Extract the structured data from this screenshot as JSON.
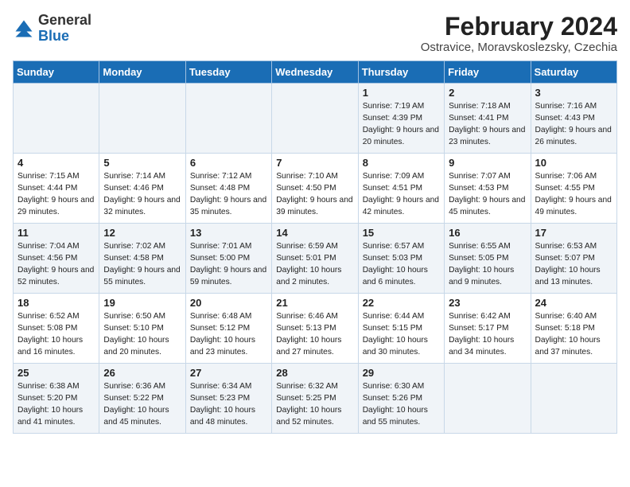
{
  "logo": {
    "general": "General",
    "blue": "Blue"
  },
  "title": "February 2024",
  "subtitle": "Ostravice, Moravskoslezsky, Czechia",
  "headers": [
    "Sunday",
    "Monday",
    "Tuesday",
    "Wednesday",
    "Thursday",
    "Friday",
    "Saturday"
  ],
  "weeks": [
    [
      {
        "day": "",
        "sunrise": "",
        "sunset": "",
        "daylight": ""
      },
      {
        "day": "",
        "sunrise": "",
        "sunset": "",
        "daylight": ""
      },
      {
        "day": "",
        "sunrise": "",
        "sunset": "",
        "daylight": ""
      },
      {
        "day": "",
        "sunrise": "",
        "sunset": "",
        "daylight": ""
      },
      {
        "day": "1",
        "sunrise": "Sunrise: 7:19 AM",
        "sunset": "Sunset: 4:39 PM",
        "daylight": "Daylight: 9 hours and 20 minutes."
      },
      {
        "day": "2",
        "sunrise": "Sunrise: 7:18 AM",
        "sunset": "Sunset: 4:41 PM",
        "daylight": "Daylight: 9 hours and 23 minutes."
      },
      {
        "day": "3",
        "sunrise": "Sunrise: 7:16 AM",
        "sunset": "Sunset: 4:43 PM",
        "daylight": "Daylight: 9 hours and 26 minutes."
      }
    ],
    [
      {
        "day": "4",
        "sunrise": "Sunrise: 7:15 AM",
        "sunset": "Sunset: 4:44 PM",
        "daylight": "Daylight: 9 hours and 29 minutes."
      },
      {
        "day": "5",
        "sunrise": "Sunrise: 7:14 AM",
        "sunset": "Sunset: 4:46 PM",
        "daylight": "Daylight: 9 hours and 32 minutes."
      },
      {
        "day": "6",
        "sunrise": "Sunrise: 7:12 AM",
        "sunset": "Sunset: 4:48 PM",
        "daylight": "Daylight: 9 hours and 35 minutes."
      },
      {
        "day": "7",
        "sunrise": "Sunrise: 7:10 AM",
        "sunset": "Sunset: 4:50 PM",
        "daylight": "Daylight: 9 hours and 39 minutes."
      },
      {
        "day": "8",
        "sunrise": "Sunrise: 7:09 AM",
        "sunset": "Sunset: 4:51 PM",
        "daylight": "Daylight: 9 hours and 42 minutes."
      },
      {
        "day": "9",
        "sunrise": "Sunrise: 7:07 AM",
        "sunset": "Sunset: 4:53 PM",
        "daylight": "Daylight: 9 hours and 45 minutes."
      },
      {
        "day": "10",
        "sunrise": "Sunrise: 7:06 AM",
        "sunset": "Sunset: 4:55 PM",
        "daylight": "Daylight: 9 hours and 49 minutes."
      }
    ],
    [
      {
        "day": "11",
        "sunrise": "Sunrise: 7:04 AM",
        "sunset": "Sunset: 4:56 PM",
        "daylight": "Daylight: 9 hours and 52 minutes."
      },
      {
        "day": "12",
        "sunrise": "Sunrise: 7:02 AM",
        "sunset": "Sunset: 4:58 PM",
        "daylight": "Daylight: 9 hours and 55 minutes."
      },
      {
        "day": "13",
        "sunrise": "Sunrise: 7:01 AM",
        "sunset": "Sunset: 5:00 PM",
        "daylight": "Daylight: 9 hours and 59 minutes."
      },
      {
        "day": "14",
        "sunrise": "Sunrise: 6:59 AM",
        "sunset": "Sunset: 5:01 PM",
        "daylight": "Daylight: 10 hours and 2 minutes."
      },
      {
        "day": "15",
        "sunrise": "Sunrise: 6:57 AM",
        "sunset": "Sunset: 5:03 PM",
        "daylight": "Daylight: 10 hours and 6 minutes."
      },
      {
        "day": "16",
        "sunrise": "Sunrise: 6:55 AM",
        "sunset": "Sunset: 5:05 PM",
        "daylight": "Daylight: 10 hours and 9 minutes."
      },
      {
        "day": "17",
        "sunrise": "Sunrise: 6:53 AM",
        "sunset": "Sunset: 5:07 PM",
        "daylight": "Daylight: 10 hours and 13 minutes."
      }
    ],
    [
      {
        "day": "18",
        "sunrise": "Sunrise: 6:52 AM",
        "sunset": "Sunset: 5:08 PM",
        "daylight": "Daylight: 10 hours and 16 minutes."
      },
      {
        "day": "19",
        "sunrise": "Sunrise: 6:50 AM",
        "sunset": "Sunset: 5:10 PM",
        "daylight": "Daylight: 10 hours and 20 minutes."
      },
      {
        "day": "20",
        "sunrise": "Sunrise: 6:48 AM",
        "sunset": "Sunset: 5:12 PM",
        "daylight": "Daylight: 10 hours and 23 minutes."
      },
      {
        "day": "21",
        "sunrise": "Sunrise: 6:46 AM",
        "sunset": "Sunset: 5:13 PM",
        "daylight": "Daylight: 10 hours and 27 minutes."
      },
      {
        "day": "22",
        "sunrise": "Sunrise: 6:44 AM",
        "sunset": "Sunset: 5:15 PM",
        "daylight": "Daylight: 10 hours and 30 minutes."
      },
      {
        "day": "23",
        "sunrise": "Sunrise: 6:42 AM",
        "sunset": "Sunset: 5:17 PM",
        "daylight": "Daylight: 10 hours and 34 minutes."
      },
      {
        "day": "24",
        "sunrise": "Sunrise: 6:40 AM",
        "sunset": "Sunset: 5:18 PM",
        "daylight": "Daylight: 10 hours and 37 minutes."
      }
    ],
    [
      {
        "day": "25",
        "sunrise": "Sunrise: 6:38 AM",
        "sunset": "Sunset: 5:20 PM",
        "daylight": "Daylight: 10 hours and 41 minutes."
      },
      {
        "day": "26",
        "sunrise": "Sunrise: 6:36 AM",
        "sunset": "Sunset: 5:22 PM",
        "daylight": "Daylight: 10 hours and 45 minutes."
      },
      {
        "day": "27",
        "sunrise": "Sunrise: 6:34 AM",
        "sunset": "Sunset: 5:23 PM",
        "daylight": "Daylight: 10 hours and 48 minutes."
      },
      {
        "day": "28",
        "sunrise": "Sunrise: 6:32 AM",
        "sunset": "Sunset: 5:25 PM",
        "daylight": "Daylight: 10 hours and 52 minutes."
      },
      {
        "day": "29",
        "sunrise": "Sunrise: 6:30 AM",
        "sunset": "Sunset: 5:26 PM",
        "daylight": "Daylight: 10 hours and 55 minutes."
      },
      {
        "day": "",
        "sunrise": "",
        "sunset": "",
        "daylight": ""
      },
      {
        "day": "",
        "sunrise": "",
        "sunset": "",
        "daylight": ""
      }
    ]
  ]
}
